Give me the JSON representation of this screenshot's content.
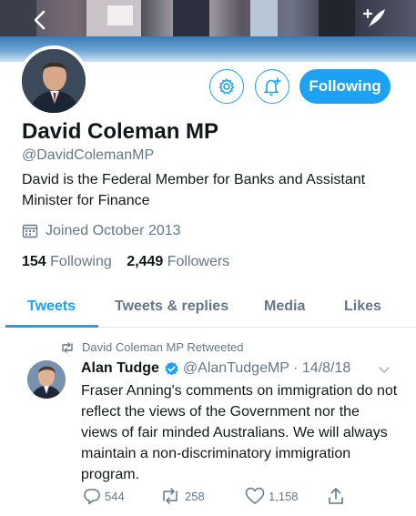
{
  "profile": {
    "name": "David Coleman MP",
    "handle": "@DavidColemanMP",
    "bio": "David is the Federal Member for Banks and Assistant Minister for Finance",
    "joined": "Joined October 2013",
    "following_count": "154",
    "following_label": "Following",
    "followers_count": "2,449",
    "followers_label": "Followers",
    "follow_button": "Following"
  },
  "tabs": [
    "Tweets",
    "Tweets & replies",
    "Media",
    "Likes"
  ],
  "tweet": {
    "retweeted_by": "David Coleman MP Retweeted",
    "author": "Alan Tudge",
    "handle_date": "@AlanTudgeMP · 14/8/18",
    "text": "Fraser Anning's comments on immigration do not reflect the views of the Government nor the views of fair minded Australians. We will always maintain a non-discriminatory immigration program.",
    "replies": "544",
    "retweets": "258",
    "likes": "1,158"
  },
  "colors": {
    "accent": "#1da1f2",
    "text": "#14171a",
    "muted": "#657786",
    "divider": "#e1e8ed",
    "retweet_green": "#17bf63"
  },
  "icons": [
    "back-arrow-icon",
    "compose-icon",
    "gear-icon",
    "bell-plus-icon",
    "calendar-icon",
    "retweet-icon",
    "verified-icon",
    "chevron-down-icon",
    "reply-icon",
    "like-icon",
    "share-icon"
  ]
}
